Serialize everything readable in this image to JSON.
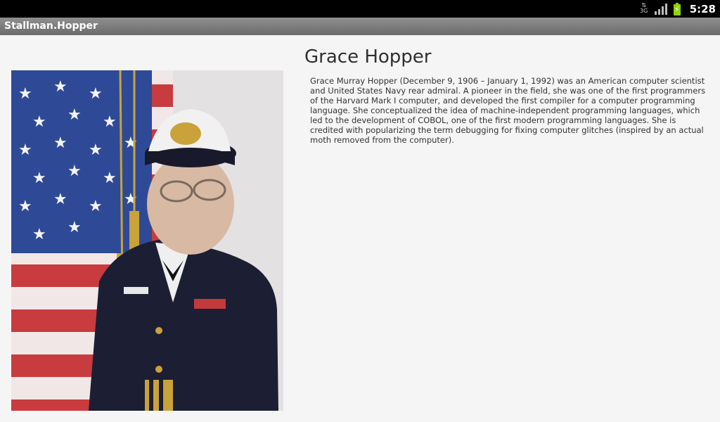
{
  "status_bar": {
    "network_type": "3G",
    "time": "5:28",
    "icons": [
      "data-3g-icon",
      "signal-strength-icon",
      "battery-charging-icon"
    ]
  },
  "app": {
    "title": "Stallman.Hopper"
  },
  "person": {
    "name": "Grace Hopper",
    "bio": "Grace Murray Hopper (December 9, 1906 – January 1, 1992) was an American computer scientist and United States Navy rear admiral. A pioneer in the field, she was one of the first programmers of the Harvard Mark I computer, and developed the first compiler for a computer programming language. She conceptualized the idea of machine-independent programming languages, which led to the development of COBOL, one of the first modern programming languages. She is credited with popularizing the term debugging for fixing computer glitches (inspired by an actual moth removed from the computer)."
  }
}
